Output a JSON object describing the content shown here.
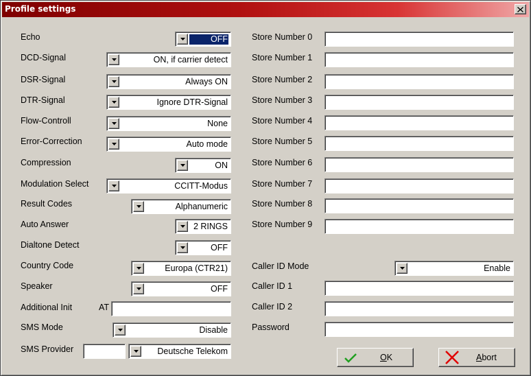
{
  "window": {
    "title": "Profile settings",
    "close_glyph": "×"
  },
  "left": {
    "echo": {
      "label": "Echo",
      "value": "OFF"
    },
    "dcd": {
      "label": "DCD-Signal",
      "value": "ON, if carrier detect"
    },
    "dsr": {
      "label": "DSR-Signal",
      "value": "Always ON"
    },
    "dtr": {
      "label": "DTR-Signal",
      "value": "Ignore DTR-Signal"
    },
    "flow": {
      "label": "Flow-Controll",
      "value": "None"
    },
    "error": {
      "label": "Error-Correction",
      "value": "Auto mode"
    },
    "compression": {
      "label": "Compression",
      "value": "ON"
    },
    "modulation": {
      "label": "Modulation Select",
      "value": "CCITT-Modus"
    },
    "result": {
      "label": "Result Codes",
      "value": "Alphanumeric"
    },
    "auto_answer": {
      "label": "Auto Answer",
      "value": "2 RINGS"
    },
    "dialtone": {
      "label": "Dialtone Detect",
      "value": "OFF"
    },
    "country": {
      "label": "Country Code",
      "value": "Europa (CTR21)"
    },
    "speaker": {
      "label": "Speaker",
      "value": "OFF"
    },
    "additional_init": {
      "label": "Additional Init",
      "prefix": "AT",
      "value": ""
    },
    "sms_mode": {
      "label": "SMS Mode",
      "value": "Disable"
    },
    "sms_provider": {
      "label": "SMS Provider",
      "number": "",
      "value": "Deutsche Telekom"
    }
  },
  "right": {
    "store_numbers": [
      {
        "label": "Store Number 0",
        "value": ""
      },
      {
        "label": "Store Number 1",
        "value": ""
      },
      {
        "label": "Store Number 2",
        "value": ""
      },
      {
        "label": "Store Number 3",
        "value": ""
      },
      {
        "label": "Store Number 4",
        "value": ""
      },
      {
        "label": "Store Number 5",
        "value": ""
      },
      {
        "label": "Store Number 6",
        "value": ""
      },
      {
        "label": "Store Number 7",
        "value": ""
      },
      {
        "label": "Store Number 8",
        "value": ""
      },
      {
        "label": "Store Number 9",
        "value": ""
      }
    ],
    "caller_id_mode": {
      "label": "Caller ID Mode",
      "value": "Enable"
    },
    "caller_id_1": {
      "label": "Caller ID 1",
      "value": ""
    },
    "caller_id_2": {
      "label": "Caller ID 2",
      "value": ""
    },
    "password": {
      "label": "Password",
      "value": ""
    }
  },
  "buttons": {
    "ok": {
      "label": "OK",
      "icon": "checkmark-icon"
    },
    "abort": {
      "label": "Abort",
      "icon": "x-cross-icon"
    }
  },
  "colors": {
    "title_gradient_start": "#7e0000",
    "title_gradient_end": "#f0a8a8",
    "face": "#d4d0c8",
    "selection": "#0a246a",
    "ok_check": "#20a020",
    "abort_cross": "#e00000"
  }
}
